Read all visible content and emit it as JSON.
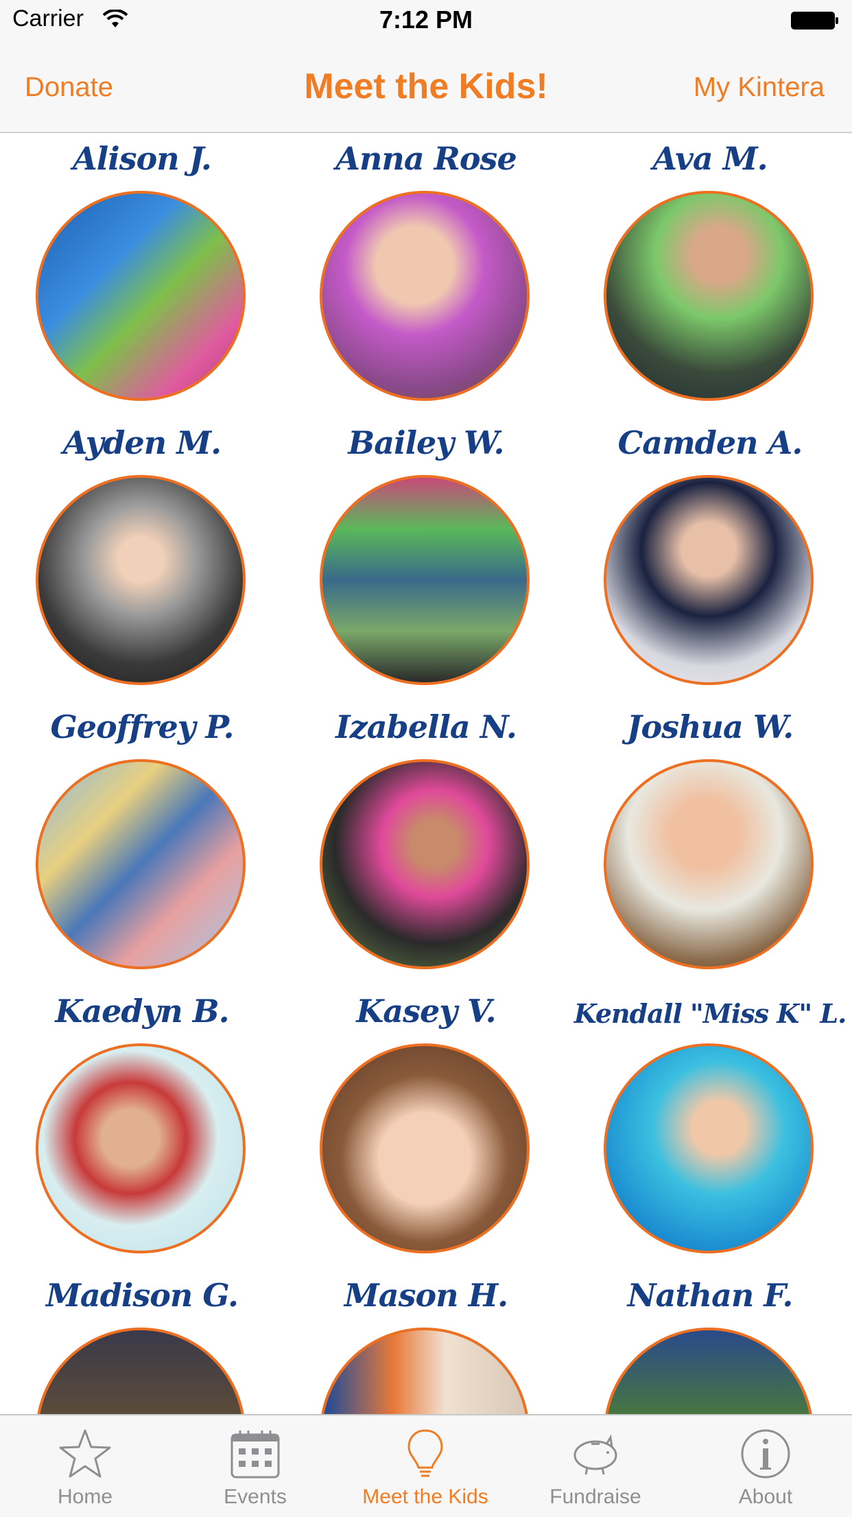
{
  "status_bar": {
    "carrier": "Carrier",
    "time": "7:12 PM"
  },
  "nav": {
    "left_label": "Donate",
    "title": "Meet the Kids!",
    "right_label": "My Kintera"
  },
  "kids": [
    {
      "name": "Alison J."
    },
    {
      "name": "Anna Rose"
    },
    {
      "name": "Ava M."
    },
    {
      "name": "Ayden M."
    },
    {
      "name": "Bailey W."
    },
    {
      "name": "Camden A."
    },
    {
      "name": "Geoffrey P."
    },
    {
      "name": "Izabella N."
    },
    {
      "name": "Joshua W."
    },
    {
      "name": "Kaedyn B."
    },
    {
      "name": "Kasey V."
    },
    {
      "name": "Kendall \"Miss K\" L."
    },
    {
      "name": "Madison G."
    },
    {
      "name": "Mason H."
    },
    {
      "name": "Nathan F."
    }
  ],
  "tabs": [
    {
      "label": "Home",
      "icon": "star-icon"
    },
    {
      "label": "Events",
      "icon": "calendar-icon"
    },
    {
      "label": "Meet the Kids",
      "icon": "lightbulb-icon",
      "active": true
    },
    {
      "label": "Fundraise",
      "icon": "piggy-bank-icon"
    },
    {
      "label": "About",
      "icon": "info-icon"
    }
  ],
  "colors": {
    "accent": "#f07c24",
    "name_text": "#163f86",
    "photo_border": "#ec6f22"
  }
}
